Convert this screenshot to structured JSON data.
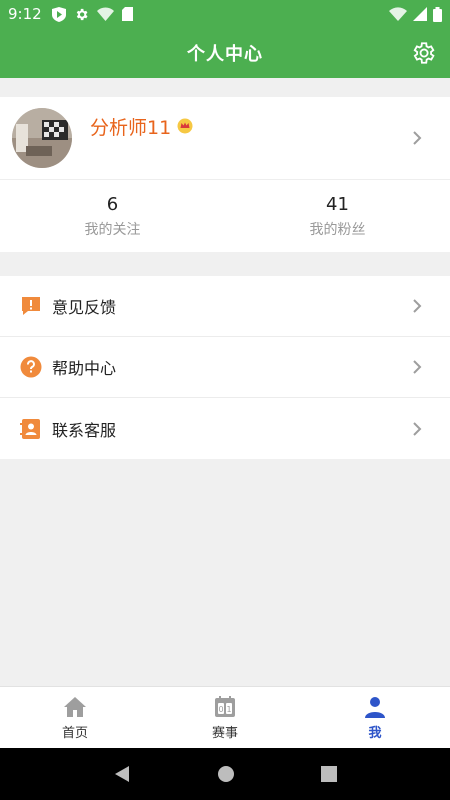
{
  "status_bar": {
    "time": "9:12"
  },
  "header": {
    "title": "个人中心",
    "settings_icon": "gear-icon"
  },
  "profile": {
    "username": "分析师11",
    "badge_icon": "crown-icon",
    "stats": [
      {
        "count": "6",
        "label": "我的关注"
      },
      {
        "count": "41",
        "label": "我的粉丝"
      }
    ]
  },
  "menu": [
    {
      "label": "意见反馈",
      "icon": "feedback-icon"
    },
    {
      "label": "帮助中心",
      "icon": "help-icon"
    },
    {
      "label": "联系客服",
      "icon": "customer-service-icon"
    }
  ],
  "tabs": [
    {
      "label": "首页",
      "icon": "home-icon",
      "active": false
    },
    {
      "label": "赛事",
      "icon": "scoreboard-icon",
      "active": false
    },
    {
      "label": "我",
      "icon": "user-icon",
      "active": true
    }
  ],
  "colors": {
    "primary": "#4caf50",
    "username": "#e8641c",
    "icon_orange": "#f08a3c",
    "tab_active": "#2e55c9"
  }
}
